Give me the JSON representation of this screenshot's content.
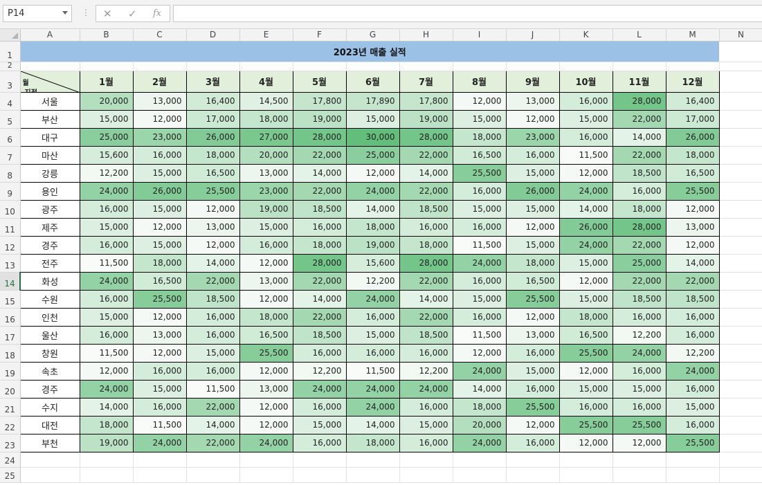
{
  "name_box": {
    "value": "P14"
  },
  "formula_bar": {
    "value": ""
  },
  "icons": {
    "cancel": "✕",
    "enter": "✓",
    "function": "fx"
  },
  "columns": [
    "A",
    "B",
    "C",
    "D",
    "E",
    "F",
    "G",
    "H",
    "I",
    "J",
    "K",
    "L",
    "M",
    "N"
  ],
  "active_row": 14,
  "row_count": 25,
  "sheet": {
    "title": "2023년 매출 실적",
    "corner_label_month": "월",
    "corner_label_branch": "지점",
    "months": [
      "1월",
      "2월",
      "3월",
      "4월",
      "5월",
      "6월",
      "7월",
      "8월",
      "9월",
      "10월",
      "11월",
      "12월"
    ],
    "rows": [
      {
        "branch": "서울",
        "values": [
          "20,000",
          "13,000",
          "16,400",
          "14,500",
          "17,800",
          "17,890",
          "17,800",
          "12,000",
          "13,000",
          "16,000",
          "28,000",
          "16,400"
        ]
      },
      {
        "branch": "부산",
        "values": [
          "15,000",
          "12,000",
          "17,000",
          "18,000",
          "19,000",
          "15,000",
          "19,000",
          "15,000",
          "12,000",
          "15,000",
          "22,000",
          "17,000"
        ]
      },
      {
        "branch": "대구",
        "values": [
          "25,000",
          "23,000",
          "26,000",
          "27,000",
          "28,000",
          "30,000",
          "28,000",
          "18,000",
          "23,000",
          "16,000",
          "14,000",
          "26,000"
        ]
      },
      {
        "branch": "마산",
        "values": [
          "15,600",
          "16,000",
          "18,000",
          "20,000",
          "22,000",
          "25,000",
          "22,000",
          "16,500",
          "16,000",
          "11,500",
          "22,000",
          "18,000"
        ]
      },
      {
        "branch": "강릉",
        "values": [
          "12,200",
          "15,000",
          "16,500",
          "13,000",
          "14,000",
          "12,000",
          "14,000",
          "25,500",
          "15,000",
          "12,000",
          "18,500",
          "16,500"
        ]
      },
      {
        "branch": "용인",
        "values": [
          "24,000",
          "26,000",
          "25,500",
          "23,000",
          "22,000",
          "24,000",
          "22,000",
          "16,000",
          "26,000",
          "24,000",
          "16,000",
          "25,500"
        ]
      },
      {
        "branch": "광주",
        "values": [
          "16,000",
          "15,000",
          "12,000",
          "19,000",
          "18,500",
          "14,000",
          "18,500",
          "15,000",
          "15,000",
          "14,000",
          "18,000",
          "12,000"
        ]
      },
      {
        "branch": "제주",
        "values": [
          "15,000",
          "12,000",
          "13,000",
          "15,000",
          "16,000",
          "18,000",
          "16,000",
          "16,000",
          "12,000",
          "26,000",
          "28,000",
          "13,000"
        ]
      },
      {
        "branch": "경주",
        "values": [
          "16,000",
          "15,000",
          "12,000",
          "16,000",
          "18,000",
          "19,000",
          "18,000",
          "11,500",
          "15,000",
          "24,000",
          "22,000",
          "12,000"
        ]
      },
      {
        "branch": "전주",
        "values": [
          "11,500",
          "18,000",
          "14,000",
          "12,000",
          "28,000",
          "15,600",
          "28,000",
          "24,000",
          "18,000",
          "15,000",
          "25,000",
          "14,000"
        ]
      },
      {
        "branch": "화성",
        "values": [
          "24,000",
          "16,500",
          "22,000",
          "13,000",
          "22,000",
          "12,200",
          "22,000",
          "16,000",
          "16,500",
          "12,000",
          "22,000",
          "22,000"
        ]
      },
      {
        "branch": "수원",
        "values": [
          "16,000",
          "25,500",
          "18,500",
          "12,000",
          "14,000",
          "24,000",
          "14,000",
          "15,000",
          "25,500",
          "15,000",
          "18,500",
          "18,500"
        ]
      },
      {
        "branch": "인천",
        "values": [
          "15,000",
          "12,000",
          "16,000",
          "18,000",
          "22,000",
          "16,000",
          "22,000",
          "16,000",
          "12,000",
          "18,000",
          "16,000",
          "16,000"
        ]
      },
      {
        "branch": "울산",
        "values": [
          "16,000",
          "13,000",
          "16,000",
          "16,500",
          "18,500",
          "15,000",
          "18,500",
          "11,500",
          "13,000",
          "16,500",
          "12,200",
          "16,000"
        ]
      },
      {
        "branch": "창원",
        "values": [
          "11,500",
          "12,000",
          "15,000",
          "25,500",
          "16,000",
          "16,000",
          "16,000",
          "12,000",
          "16,000",
          "25,500",
          "24,000",
          "12,200"
        ]
      },
      {
        "branch": "속초",
        "values": [
          "12,000",
          "16,000",
          "16,000",
          "12,000",
          "12,200",
          "11,500",
          "12,200",
          "24,000",
          "15,000",
          "12,000",
          "16,000",
          "24,000"
        ]
      },
      {
        "branch": "경주",
        "values": [
          "24,000",
          "15,000",
          "11,500",
          "13,000",
          "24,000",
          "24,000",
          "24,000",
          "14,000",
          "16,000",
          "15,000",
          "15,000",
          "16,000"
        ]
      },
      {
        "branch": "수지",
        "values": [
          "14,000",
          "16,000",
          "22,000",
          "12,000",
          "16,000",
          "24,000",
          "16,000",
          "18,000",
          "25,500",
          "16,000",
          "16,000",
          "15,000"
        ]
      },
      {
        "branch": "대전",
        "values": [
          "18,000",
          "11,500",
          "14,000",
          "12,000",
          "15,000",
          "14,000",
          "15,000",
          "20,000",
          "12,000",
          "25,500",
          "25,500",
          "16,000"
        ]
      },
      {
        "branch": "부천",
        "values": [
          "19,000",
          "24,000",
          "22,000",
          "24,000",
          "16,000",
          "18,000",
          "16,000",
          "24,000",
          "16,000",
          "12,000",
          "12,000",
          "25,500"
        ]
      }
    ]
  },
  "colors": {
    "title_fill": "#9bc2e6",
    "header_fill": "#e2efda",
    "scale_low": "#f8fbf8",
    "scale_high": "#63be7b",
    "active_accent": "#1e7145"
  }
}
